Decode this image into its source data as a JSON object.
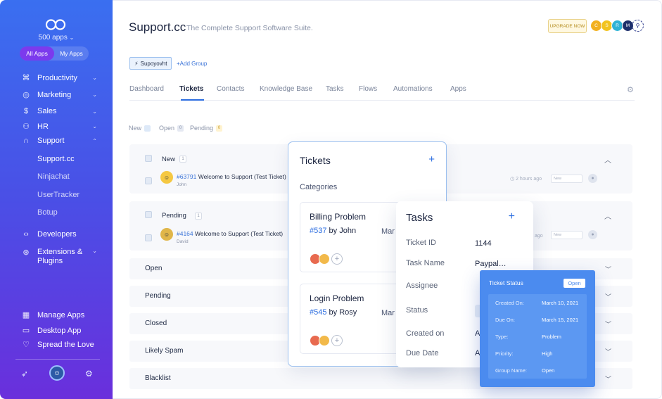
{
  "sidebar": {
    "apps_count": "500 apps",
    "toggle": {
      "all": "All Apps",
      "mine": "My Apps"
    },
    "items": [
      {
        "label": "Productivity",
        "icon": "command-icon"
      },
      {
        "label": "Marketing",
        "icon": "target-icon"
      },
      {
        "label": "Sales",
        "icon": "dollar-icon"
      },
      {
        "label": "HR",
        "icon": "people-icon"
      },
      {
        "label": "Support",
        "icon": "headset-icon"
      },
      {
        "label": "Developers",
        "icon": "code-icon"
      },
      {
        "label": "Extensions & Plugins",
        "icon": "plugin-icon"
      }
    ],
    "support_sub": [
      "Support.cc",
      "Ninjachat",
      "UserTracker",
      "Botup"
    ],
    "footer": [
      {
        "label": "Manage Apps",
        "icon": "grid-icon"
      },
      {
        "label": "Desktop App",
        "icon": "monitor-icon"
      },
      {
        "label": "Spread the Love",
        "icon": "heart-icon"
      }
    ]
  },
  "header": {
    "title": "Support.cc",
    "subtitle": "The Complete Support Software Suite.",
    "upgrade": "UPGRADE NOW",
    "avatars": [
      {
        "letter": "C",
        "color": "#f2b01e"
      },
      {
        "letter": "S",
        "color": "#f2c31e"
      },
      {
        "letter": "R",
        "color": "#2fb3d6"
      },
      {
        "letter": "M",
        "color": "#1d2f6b"
      }
    ]
  },
  "group": {
    "chip": "Supoyovht",
    "add": "+Add Group"
  },
  "tabs": [
    "Dashboard",
    "Tickets",
    "Contacts",
    "Knowledge Base",
    "Tasks",
    "Flows",
    "Automations",
    "Apps"
  ],
  "filters": [
    {
      "label": "New",
      "count": ""
    },
    {
      "label": "Open",
      "count": "0"
    },
    {
      "label": "Pending",
      "count": "0"
    }
  ],
  "panel_new": {
    "label": "New",
    "count": "1",
    "ticket_id": "#63791",
    "ticket_title": "Welcome to Support (Test Ticket)",
    "author": "John",
    "time": "2 hours ago",
    "select": "New"
  },
  "panel_pending": {
    "label": "Pending",
    "count": "1",
    "ticket_id": "#4164",
    "ticket_title": "Welcome to Support (Test Ticket)",
    "author": "David",
    "time": "ago",
    "select": "New"
  },
  "rows": [
    "Open",
    "Pending",
    "Closed",
    "Likely Spam",
    "Blacklist"
  ],
  "tickets_card": {
    "title": "Tickets",
    "categories": "Categories",
    "items": [
      {
        "title": "Billing Problem",
        "id": "#537",
        "by": "by John",
        "trail": "Mar"
      },
      {
        "title": "Login Problem",
        "id": "#545",
        "by": "by Rosy",
        "trail": "Mar"
      }
    ]
  },
  "tasks_card": {
    "title": "Tasks",
    "fields": [
      {
        "k": "Ticket ID",
        "v": "1144"
      },
      {
        "k": "Task Name",
        "v": "Paypal…"
      },
      {
        "k": "Assignee",
        "v": ""
      },
      {
        "k": "Status",
        "v": ""
      },
      {
        "k": "Created on",
        "v": "A"
      },
      {
        "k": "Due Date",
        "v": "A"
      }
    ]
  },
  "status_card": {
    "title": "Ticket Status",
    "badge": "Open",
    "fields": [
      {
        "k": "Created On:",
        "v": "March 10, 2021"
      },
      {
        "k": "Due On:",
        "v": "March 15, 2021"
      },
      {
        "k": "Type:",
        "v": "Problem"
      },
      {
        "k": "Priority:",
        "v": "High"
      },
      {
        "k": "Group Name:",
        "v": "Open"
      }
    ]
  }
}
